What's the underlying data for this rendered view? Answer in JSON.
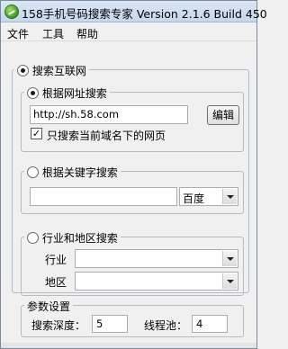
{
  "window": {
    "title": "158手机号码搜索专家 Version 2.1.6 Build 450"
  },
  "menu": {
    "items": [
      "文件",
      "工具",
      "帮助"
    ]
  },
  "internet_search": {
    "label": "搜索互联网",
    "checked": true,
    "url_search": {
      "label": "根据网址搜索",
      "checked": true,
      "url_value": "http://sh.58.com",
      "edit_button": "编辑",
      "domain_only_label": "只搜索当前域名下的网页",
      "domain_only_checked": true
    }
  },
  "keyword_search": {
    "label": "根据关键字搜索",
    "checked": false,
    "keyword_value": "",
    "engine_value": "百度"
  },
  "industry_search": {
    "label": "行业和地区搜索",
    "checked": false,
    "industry_label": "行业",
    "industry_value": "",
    "region_label": "地区",
    "region_value": ""
  },
  "params": {
    "title": "参数设置",
    "depth_label": "搜索深度：",
    "depth_value": "5",
    "threads_label": "线程池：",
    "threads_value": "4"
  }
}
